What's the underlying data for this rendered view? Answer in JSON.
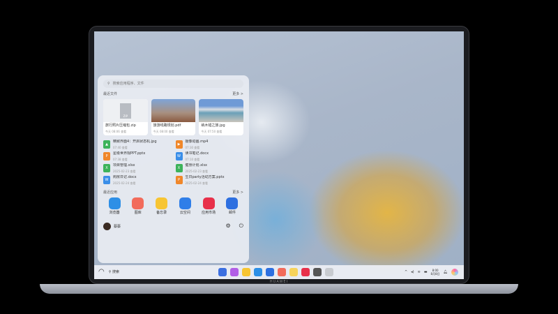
{
  "brand": "HUAWEI",
  "start_menu": {
    "search_placeholder": "搜索应用程序、文件",
    "recent_files_label": "最近文件",
    "more_label": "更多 >",
    "cards": [
      {
        "name": "旅行照片压缩包.zip",
        "meta": "今天 08:06 查看",
        "badge": "ZIP"
      },
      {
        "name": "旅游线路规划.pdf",
        "meta": "今天 08:00 查看"
      },
      {
        "name": "纳木错之旅.jpg",
        "meta": "今天 07:50 查看"
      }
    ],
    "files": [
      {
        "name": "精致界面4：开启状态机.jpg",
        "meta": "07:40 查看",
        "type": "img",
        "color": "#3cb35a",
        "glyph": "▲"
      },
      {
        "name": "摄像动画.mp4",
        "meta": "07:30 查看",
        "type": "video",
        "color": "#f0872a",
        "glyph": "▶"
      },
      {
        "name": "星级世界观PPT.pptx",
        "meta": "07:38 查看",
        "type": "ppt",
        "color": "#f0872a",
        "glyph": "P"
      },
      {
        "name": "读书笔记.docx",
        "meta": "07:10 查看",
        "type": "doc",
        "color": "#3a8ee8",
        "glyph": "W"
      },
      {
        "name": "项目管理.xlsx",
        "meta": "2025-02-23 查看",
        "type": "xls",
        "color": "#3cb35a",
        "glyph": "X"
      },
      {
        "name": "健身计划.xlsx",
        "meta": "2025-02-23 查看",
        "type": "xls",
        "color": "#3cb35a",
        "glyph": "X"
      },
      {
        "name": "购房日记.docx",
        "meta": "2025-02-24 查看",
        "type": "doc",
        "color": "#3a8ee8",
        "glyph": "W"
      },
      {
        "name": "生日party活动方案.pptx",
        "meta": "2025-02-24 查看",
        "type": "ppt",
        "color": "#f0872a",
        "glyph": "P"
      }
    ],
    "recent_apps_label": "最近应用",
    "apps": [
      {
        "name": "浏览器",
        "color": "#2d8fe6"
      },
      {
        "name": "图库",
        "color": "#f26b5b"
      },
      {
        "name": "备忘录",
        "color": "#f7c533"
      },
      {
        "name": "云空间",
        "color": "#2f7ee8"
      },
      {
        "name": "应用市场",
        "color": "#e8304a"
      },
      {
        "name": "邮件",
        "color": "#2d6fe0"
      }
    ],
    "user_name": "蔡蔡"
  },
  "taskbar": {
    "search_label": "搜索",
    "time": "8:00",
    "date": "8月8日",
    "dock": [
      {
        "name": "start",
        "color": "#3c6fe0"
      },
      {
        "name": "files",
        "color": "#b15ee6"
      },
      {
        "name": "memo",
        "color": "#f7c533"
      },
      {
        "name": "browser",
        "color": "#2d8fe6"
      },
      {
        "name": "mail",
        "color": "#2d6fe0"
      },
      {
        "name": "gallery",
        "color": "#f26b5b"
      },
      {
        "name": "notes",
        "color": "#f7d35a"
      },
      {
        "name": "appgallery",
        "color": "#e8304a"
      },
      {
        "name": "settings",
        "color": "#555"
      },
      {
        "name": "trash",
        "color": "#c8cbd0"
      }
    ]
  }
}
